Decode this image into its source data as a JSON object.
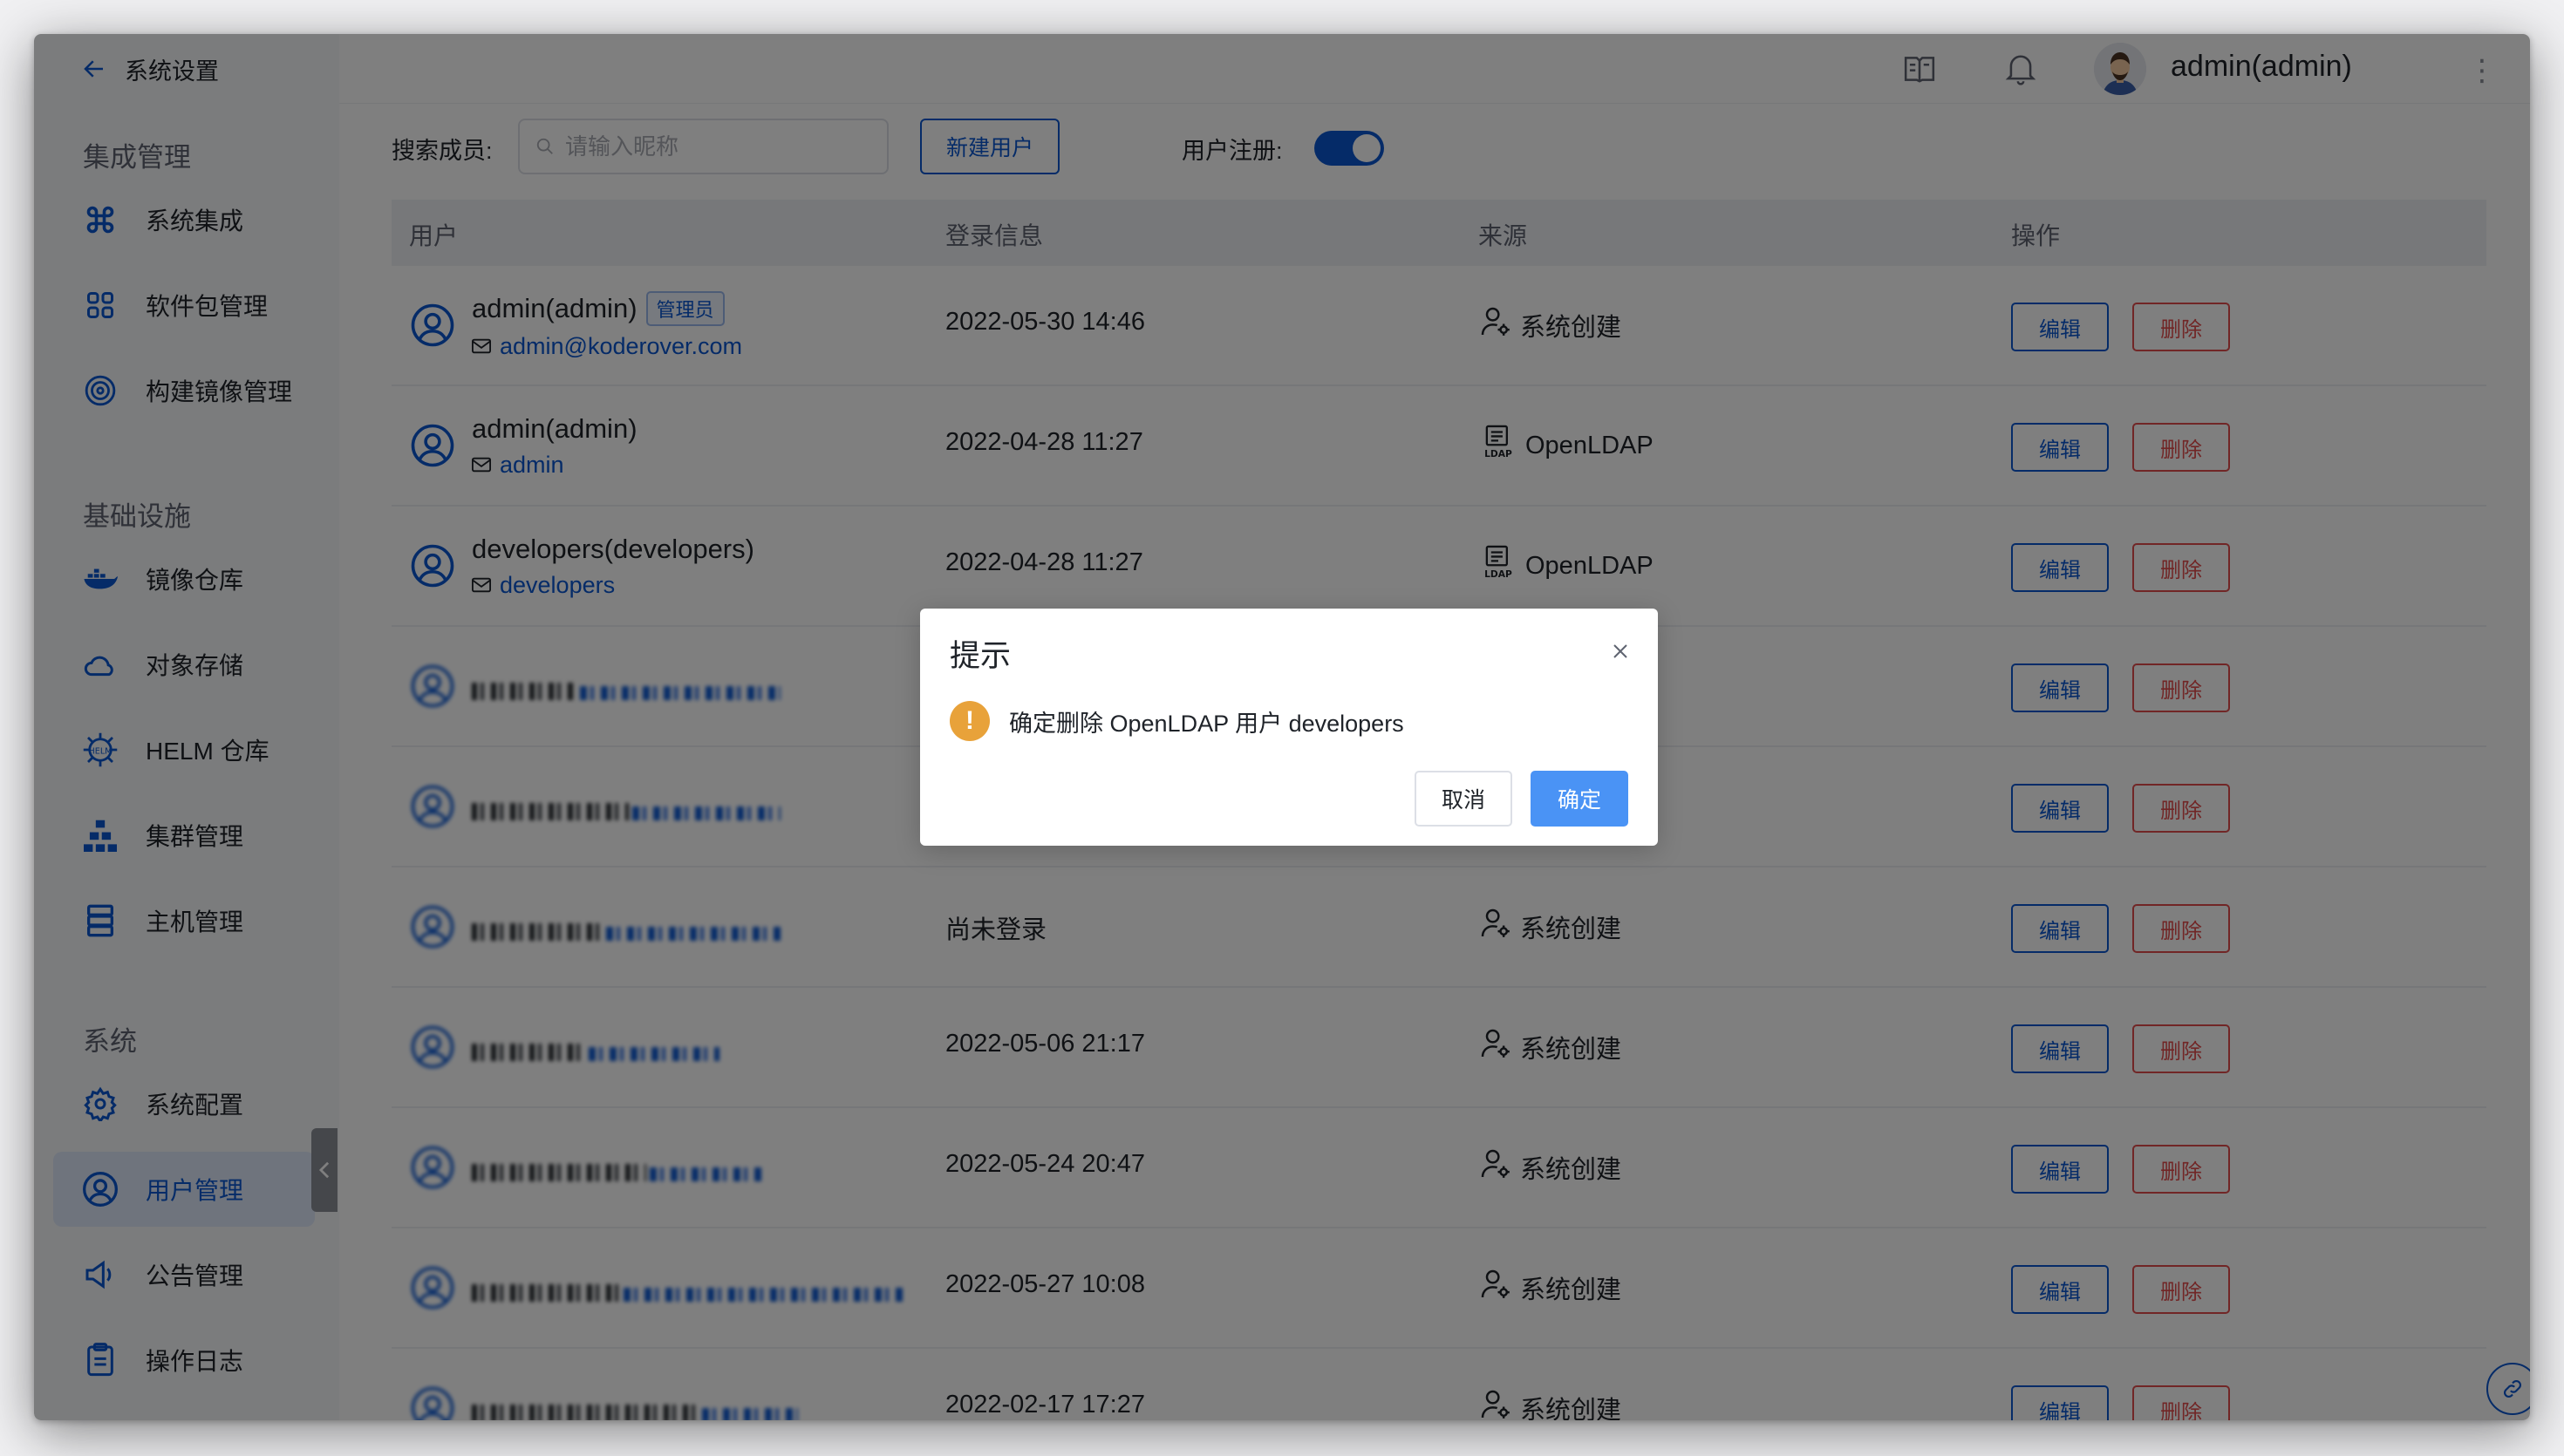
{
  "sidebar": {
    "back_label": "系统设置",
    "groups": [
      {
        "label": "集成管理"
      },
      {
        "label": "基础设施"
      },
      {
        "label": "系统"
      }
    ],
    "items": [
      {
        "label": "系统集成",
        "icon": "command-icon"
      },
      {
        "label": "软件包管理",
        "icon": "grid-icon"
      },
      {
        "label": "构建镜像管理",
        "icon": "disc-icon"
      },
      {
        "label": "镜像仓库",
        "icon": "docker-icon"
      },
      {
        "label": "对象存储",
        "icon": "cloud-icon"
      },
      {
        "label": "HELM 仓库",
        "icon": "helm-icon"
      },
      {
        "label": "集群管理",
        "icon": "cluster-icon"
      },
      {
        "label": "主机管理",
        "icon": "server-icon"
      },
      {
        "label": "系统配置",
        "icon": "settings-icon"
      },
      {
        "label": "用户管理",
        "icon": "user-icon",
        "active": true
      },
      {
        "label": "公告管理",
        "icon": "megaphone-icon"
      },
      {
        "label": "操作日志",
        "icon": "clipboard-icon"
      }
    ]
  },
  "topbar": {
    "username": "admin(admin)"
  },
  "toolbar": {
    "search_label": "搜索成员:",
    "search_placeholder": "请输入昵称",
    "new_user_label": "新建用户",
    "register_label": "用户注册:",
    "register_enabled": true
  },
  "table": {
    "headers": [
      "用户",
      "登录信息",
      "来源",
      "操作"
    ],
    "edit_label": "编辑",
    "delete_label": "删除",
    "rows": [
      {
        "name": "admin(admin)",
        "badge": "管理员",
        "email": "admin@koderover.com",
        "login": "2022-05-30 14:46",
        "source": "系统创建",
        "source_icon": "user-gear-icon"
      },
      {
        "name": "admin(admin)",
        "email": "admin",
        "login": "2022-04-28 11:27",
        "source": "OpenLDAP",
        "source_icon": "ldap-icon"
      },
      {
        "name": "developers(developers)",
        "email": "developers",
        "login": "2022-04-28 11:27",
        "source": "OpenLDAP",
        "source_icon": "ldap-icon"
      },
      {
        "blurred": true,
        "login": "",
        "source": ""
      },
      {
        "blurred": true,
        "login": "",
        "source": ""
      },
      {
        "blurred": true,
        "login": "尚未登录",
        "source": "系统创建",
        "source_icon": "user-gear-icon"
      },
      {
        "blurred": true,
        "login": "2022-05-06 21:17",
        "source": "系统创建",
        "source_icon": "user-gear-icon"
      },
      {
        "blurred": true,
        "login": "2022-05-24 20:47",
        "source": "系统创建",
        "source_icon": "user-gear-icon"
      },
      {
        "blurred": true,
        "login": "2022-05-27 10:08",
        "source": "系统创建",
        "source_icon": "user-gear-icon"
      },
      {
        "blurred": true,
        "login": "2022-02-17 17:27",
        "source": "系统创建",
        "source_icon": "user-gear-icon"
      }
    ]
  },
  "dialog": {
    "title": "提示",
    "message": "确定删除 OpenLDAP 用户 developers",
    "cancel_label": "取消",
    "confirm_label": "确定"
  },
  "colors": {
    "accent": "#0b57d0",
    "danger": "#e24d4d",
    "warning": "#e8a23a",
    "confirm": "#4a93f5"
  }
}
